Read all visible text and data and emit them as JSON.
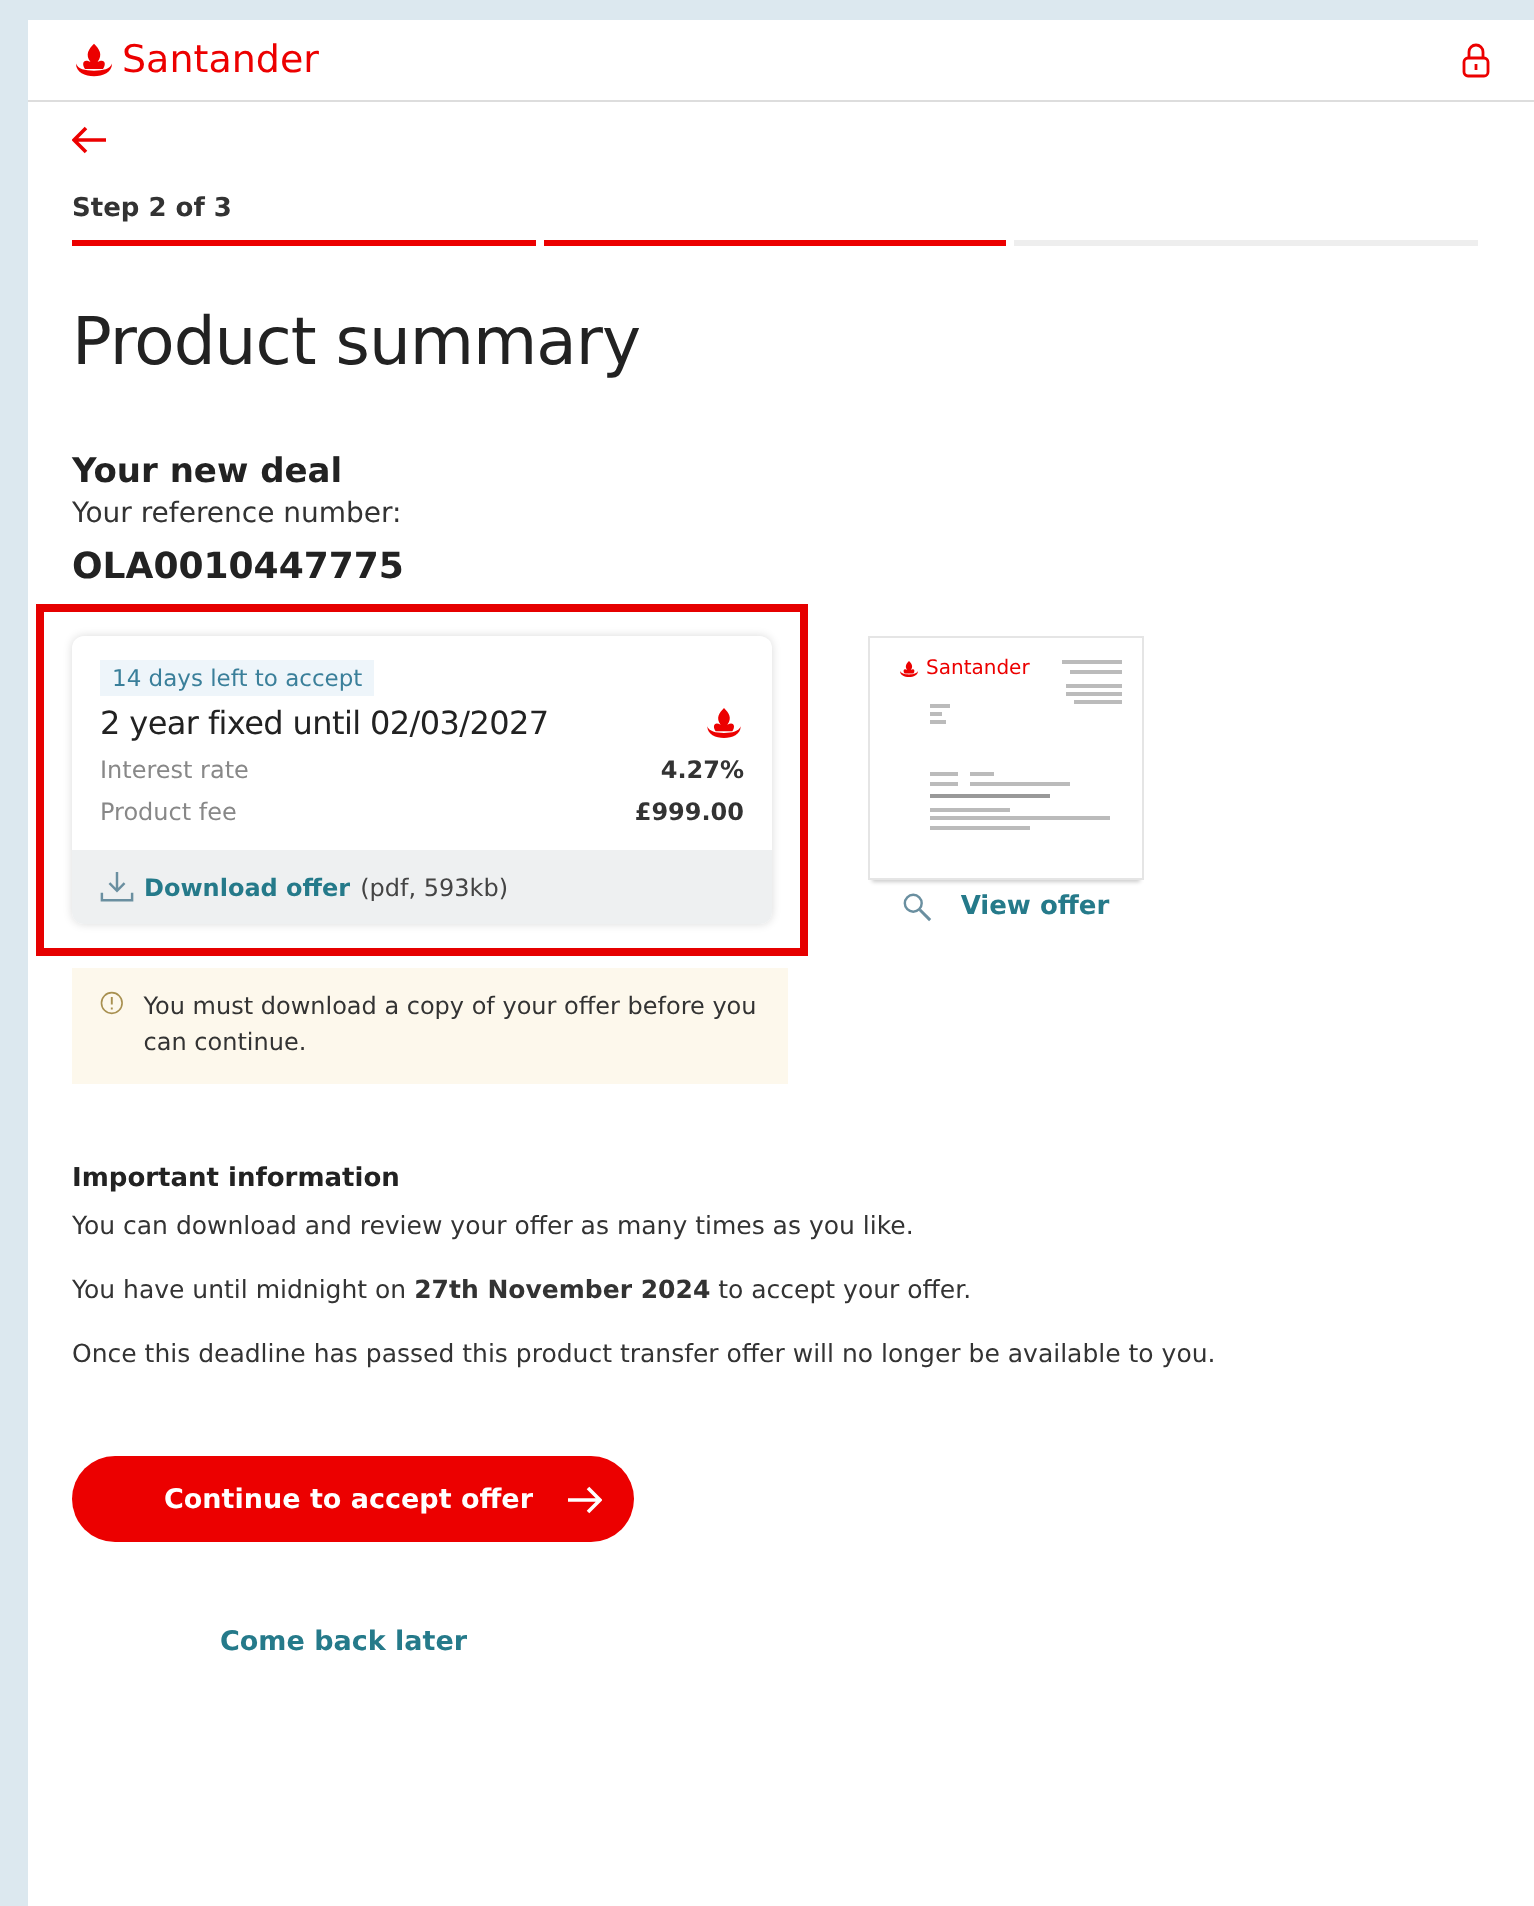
{
  "header": {
    "brand": "Santander"
  },
  "step_label": "Step 2 of 3",
  "steps": [
    {
      "complete": true
    },
    {
      "complete": true
    },
    {
      "complete": false
    }
  ],
  "title": "Product summary",
  "deal": {
    "heading": "Your new deal",
    "reference_label": "Your reference number:",
    "reference": "OLA0010447775"
  },
  "offer_card": {
    "highlighted": true,
    "badge": "14 days left to accept",
    "name": "2 year fixed until 02/03/2027",
    "rows": [
      {
        "label": "Interest rate",
        "value": "4.27%"
      },
      {
        "label": "Product fee",
        "value": "£999.00"
      }
    ],
    "download_link": "Download offer",
    "download_meta": "(pdf, 593kb)"
  },
  "preview": {
    "brand": "Santander",
    "link": "View offer"
  },
  "notice": "You must download a copy of your offer before you can continue.",
  "important": {
    "heading": "Important information",
    "paragraphs": [
      "You can download and review your offer as many times as you like.",
      "You have until midnight on **27th November 2024** to accept your offer.",
      "Once this deadline has passed this product transfer offer will no longer be available to you."
    ]
  },
  "primary_button": "Continue to accept offer",
  "secondary_link": "Come back later"
}
